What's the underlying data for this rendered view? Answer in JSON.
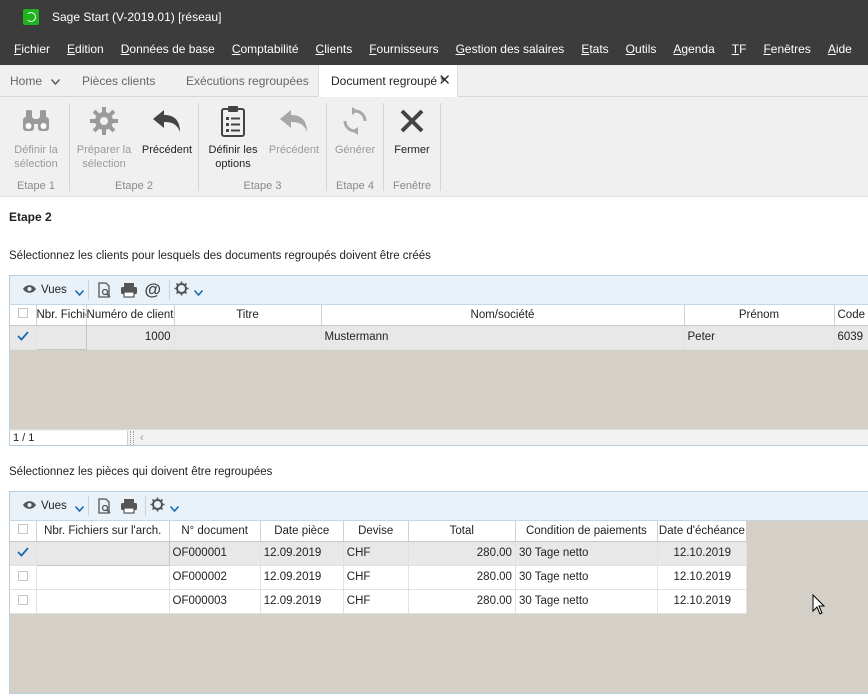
{
  "window": {
    "title": "Sage Start (V-2019.01) [réseau]"
  },
  "menu": [
    "Fichier",
    "Edition",
    "Données de base",
    "Comptabilité",
    "Clients",
    "Fournisseurs",
    "Gestion des salaires",
    "Etats",
    "Outils",
    "Agenda",
    "TF",
    "Fenêtres",
    "Aide"
  ],
  "tabs": {
    "home": "Home",
    "t2": "Pièces clients",
    "t3": "Exécutions regroupées",
    "active": "Document regroupé *"
  },
  "ribbon": {
    "b1": "Définir la sélection",
    "b2": "Préparer la sélection",
    "b3": "Précédent",
    "b4": "Définir les options",
    "b5": "Précédent",
    "b6": "Générer",
    "b7": "Fermer",
    "g1": "Etape 1",
    "g2": "Etape 2",
    "g3": "Etape 3",
    "g4": "Etape 4",
    "g5": "Fenêtre"
  },
  "page": {
    "etape": "Etape 2",
    "clients_label": "Sélectionnez les clients pour lesquels des documents regroupés doivent être créés",
    "pieces_label": "Sélectionnez les pièces qui doivent être regroupées",
    "vues": "Vues",
    "pager": "1 / 1"
  },
  "clients_table": {
    "headers": [
      "Nbr. Fichiers sur l'arch.",
      "Numéro de client",
      "Titre",
      "Nom/société",
      "Prénom",
      "Code"
    ],
    "rows": [
      {
        "checked": true,
        "nbr": "",
        "numero": "1000",
        "titre": "",
        "nom": "Mustermann",
        "prenom": "Peter",
        "code": "6039"
      }
    ]
  },
  "pieces_table": {
    "headers": [
      "Nbr. Fichiers sur l'arch.",
      "N° document",
      "Date pièce",
      "Devise",
      "Total",
      "Condition de paiements",
      "Date d'échéance"
    ],
    "rows": [
      {
        "checked": true,
        "nbr": "",
        "doc": "OF000001",
        "date": "12.09.2019",
        "devise": "CHF",
        "total": "280.00",
        "cond": "30 Tage netto",
        "echeance": "12.10.2019"
      },
      {
        "checked": false,
        "nbr": "",
        "doc": "OF000002",
        "date": "12.09.2019",
        "devise": "CHF",
        "total": "280.00",
        "cond": "30 Tage netto",
        "echeance": "12.10.2019"
      },
      {
        "checked": false,
        "nbr": "",
        "doc": "OF000003",
        "date": "12.09.2019",
        "devise": "CHF",
        "total": "280.00",
        "cond": "30 Tage netto",
        "echeance": "12.10.2019"
      }
    ]
  },
  "colors": {
    "titlebar": "#3c3c3c",
    "accent": "#1fb31f",
    "grid_empty": "#d4d0c8",
    "toolbar": "#e9f2f8"
  }
}
